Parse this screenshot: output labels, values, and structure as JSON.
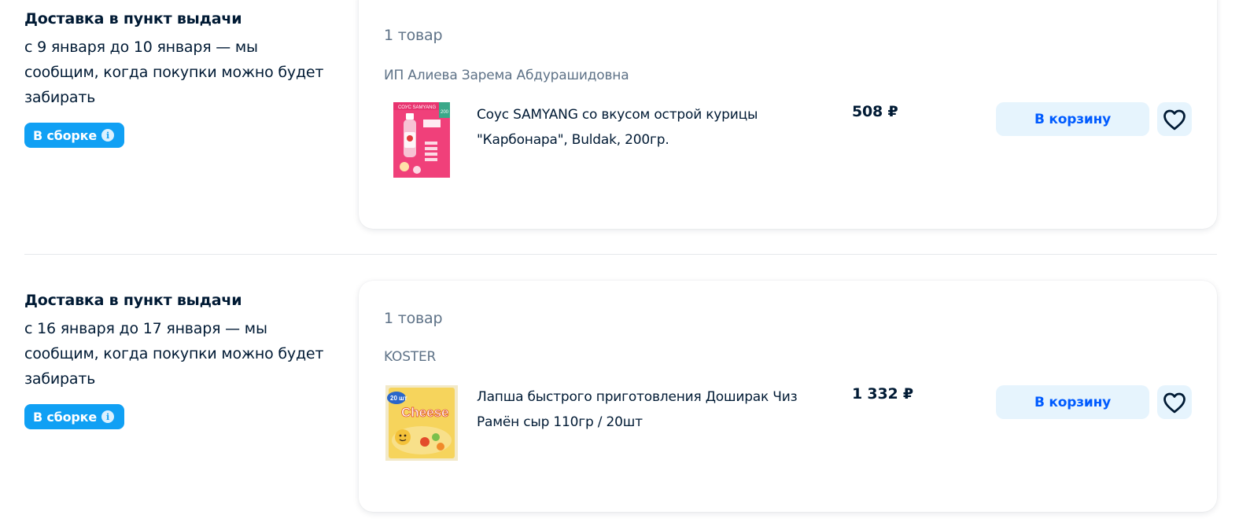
{
  "deliveries": [
    {
      "title": "Доставка в пункт выдачи",
      "dates": "с 9 января до 10 января — мы сообщим, когда покупки можно будет забирать",
      "status_badge": "В сборке",
      "card": {
        "count_label": "1 товар",
        "seller": "ИП Алиева Зарема Абдурашидовна",
        "product": {
          "name": "Соус SAMYANG со вкусом острой курицы \"Карбонара\", Buldak, 200гр.",
          "price": "508 ₽",
          "cart_label": "В корзину",
          "image_icon": "sauce-bottle-image",
          "image_text": "СОУС SAMYANG",
          "image_badge": "200"
        }
      }
    },
    {
      "title": "Доставка в пункт выдачи",
      "dates": "с 16 января до 17 января — мы сообщим, когда покупки можно будет забирать",
      "status_badge": "В сборке",
      "card": {
        "count_label": "1 товар",
        "seller": "KOSTER",
        "product": {
          "name": "Лапша быстрого приготовления Доширак Чиз Рамён сыр 110гр / 20шт",
          "price": "1 332 ₽",
          "cart_label": "В корзину",
          "image_icon": "noodle-pack-image",
          "image_text": "Cheese",
          "image_badge": "20 шт"
        }
      }
    }
  ],
  "colors": {
    "accent_blue": "#005bff",
    "badge_blue": "#10a0f4",
    "button_bg": "#e6f4fd",
    "muted_text": "#5e7287"
  },
  "icons": {
    "status_info": "info-icon",
    "favorite": "heart-icon"
  }
}
